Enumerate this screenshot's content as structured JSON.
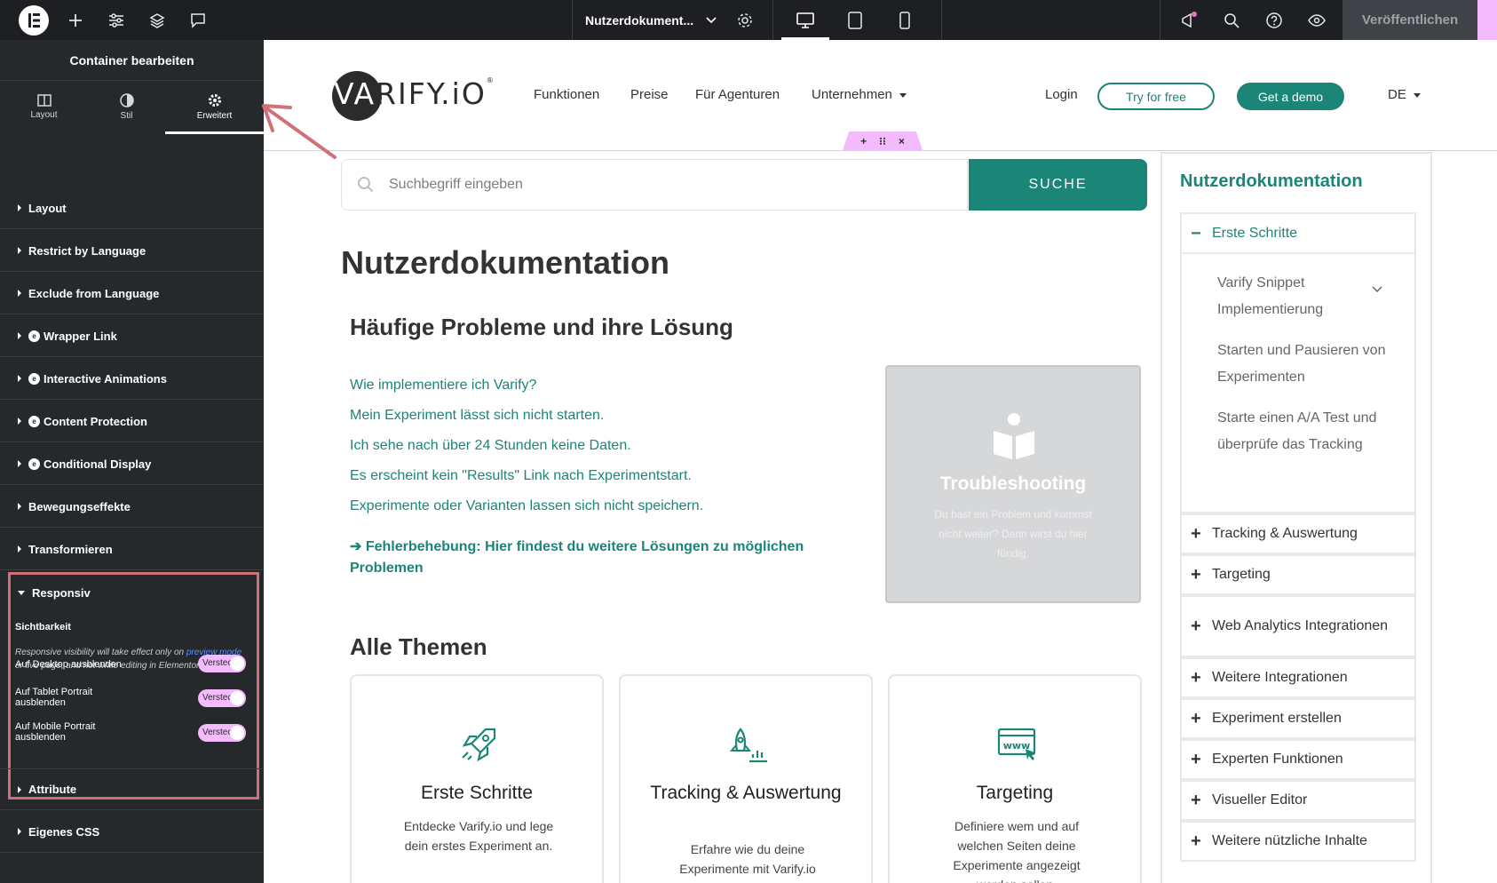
{
  "topbar": {
    "document_title": "Nutzerdokument...",
    "publish_label": "Veröffentlichen"
  },
  "panel": {
    "title": "Container bearbeiten",
    "tabs": [
      {
        "label": "Layout"
      },
      {
        "label": "Stil"
      },
      {
        "label": "Erweitert"
      }
    ],
    "sections": [
      {
        "label": "Layout",
        "pro": false
      },
      {
        "label": "Restrict by Language",
        "pro": false
      },
      {
        "label": "Exclude from Language",
        "pro": false
      },
      {
        "label": "Wrapper Link",
        "pro": true
      },
      {
        "label": "Interactive Animations",
        "pro": true
      },
      {
        "label": "Content Protection",
        "pro": true
      },
      {
        "label": "Conditional Display",
        "pro": true
      },
      {
        "label": "Bewegungseffekte",
        "pro": false
      },
      {
        "label": "Transformieren",
        "pro": false
      }
    ],
    "responsive": {
      "label": "Responsiv",
      "visibility_title": "Sichtbarkeit",
      "note_before": "Responsive visibility will take effect only on ",
      "note_link": "preview mode",
      "note_after": " or live page, and not while editing in Elementor.",
      "toggles": [
        {
          "label": "Auf Desktop ausblenden",
          "state": "Versteckt"
        },
        {
          "label": "Auf Tablet Portrait ausblenden",
          "state": "Versteckt"
        },
        {
          "label": "Auf Mobile Portrait ausblenden",
          "state": "Versteckt"
        }
      ]
    },
    "bottom_sections": [
      {
        "label": "Attribute"
      },
      {
        "label": "Eigenes CSS"
      }
    ]
  },
  "site": {
    "logo_text": "VARIFY.iO",
    "logo_mark": "®",
    "nav": {
      "functions": "Funktionen",
      "prices": "Preise",
      "agencies": "Für Agenturen",
      "company": "Unternehmen",
      "login": "Login",
      "try": "Try for free",
      "demo": "Get a demo",
      "lang": "DE"
    },
    "search": {
      "placeholder": "Suchbegriff eingeben",
      "button": "SUCHE"
    },
    "page_title": "Nutzerdokumentation",
    "faq_title": "Häufige Probleme und ihre Lösung",
    "faq_links": [
      "Wie implementiere ich Varify?",
      "Mein Experiment lässt sich nicht starten.",
      "Ich sehe nach über 24 Stunden keine Daten.",
      "Es erscheint kein \"Results\" Link nach Experimentstart.",
      "Experimente oder Varianten lassen sich nicht speichern."
    ],
    "faq_more": "➔ Fehlerbehebung: Hier findest du weitere Lösungen zu möglichen Problemen",
    "troubleshooting": {
      "title": "Troubleshooting",
      "text": "Du hast ein Problem und kommst nicht weiter? Dann wirst du hier fündig."
    },
    "themes_title": "Alle Themen",
    "themes": [
      {
        "title": "Erste Schritte",
        "text": "Entdecke Varify.io und lege dein erstes Experiment an."
      },
      {
        "title": "Tracking & Auswertung",
        "text": "Erfahre wie du deine Experimente mit Varify.io auswertest"
      },
      {
        "title": "Targeting",
        "text": "Definiere wem und auf welchen Seiten deine Experimente angezeigt werden sollen."
      }
    ],
    "sidebar": {
      "title": "Nutzerdokumentation",
      "open_item": "Erste Schritte",
      "sub_items": [
        "Varify Snippet Implementierung",
        "Starten und Pausieren von Experimenten",
        "Starte einen A/A Test und überprüfe das Tracking"
      ],
      "items": [
        "Tracking & Auswertung",
        "Targeting",
        "Web Analytics Integrationen",
        "Weitere Integrationen",
        "Experiment erstellen",
        "Experten Funktionen",
        "Visueller Editor",
        "Weitere nützliche Inhalte"
      ]
    }
  },
  "colors": {
    "brand_teal": "#1b8578",
    "editor_dark": "#26292c",
    "accent_pink": "#f3bafd",
    "highlight_red": "#d0707a"
  }
}
